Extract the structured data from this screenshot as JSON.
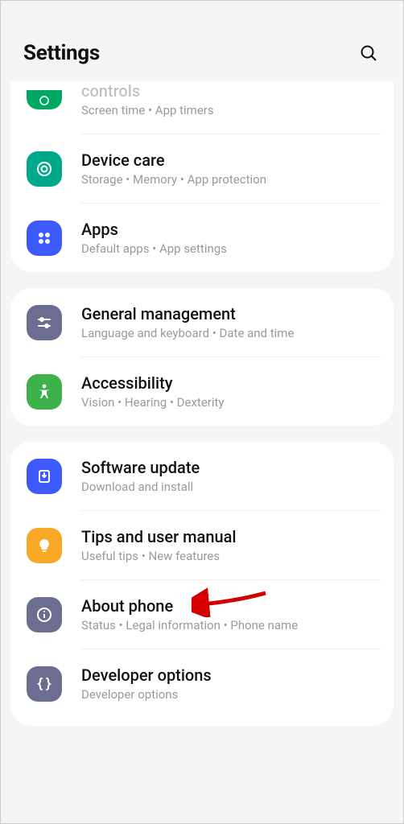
{
  "header": {
    "title": "Settings"
  },
  "groups": [
    {
      "items": [
        {
          "title_partial": "controls",
          "sub": "Screen time  •  App timers",
          "icon": "wellbeing-icon",
          "bg": "bg-green1",
          "partial": true
        },
        {
          "title": "Device care",
          "sub": "Storage  •  Memory  •  App protection",
          "icon": "device-care-icon",
          "bg": "bg-teal"
        },
        {
          "title": "Apps",
          "sub": "Default apps  •  App settings",
          "icon": "apps-icon",
          "bg": "bg-blue1"
        }
      ]
    },
    {
      "items": [
        {
          "title": "General management",
          "sub": "Language and keyboard  •  Date and time",
          "icon": "sliders-icon",
          "bg": "bg-slate"
        },
        {
          "title": "Accessibility",
          "sub": "Vision  •  Hearing  •  Dexterity",
          "icon": "accessibility-icon",
          "bg": "bg-green2"
        }
      ]
    },
    {
      "items": [
        {
          "title": "Software update",
          "sub": "Download and install",
          "icon": "download-icon",
          "bg": "bg-blue2"
        },
        {
          "title": "Tips and user manual",
          "sub": "Useful tips  •  New features",
          "icon": "lightbulb-icon",
          "bg": "bg-orange"
        },
        {
          "title": "About phone",
          "sub": "Status  •  Legal information  •  Phone name",
          "icon": "info-icon",
          "bg": "bg-slate"
        },
        {
          "title": "Developer options",
          "sub": "Developer options",
          "icon": "braces-icon",
          "bg": "bg-gray"
        }
      ]
    }
  ],
  "annotation": {
    "arrow_target": "About phone"
  }
}
